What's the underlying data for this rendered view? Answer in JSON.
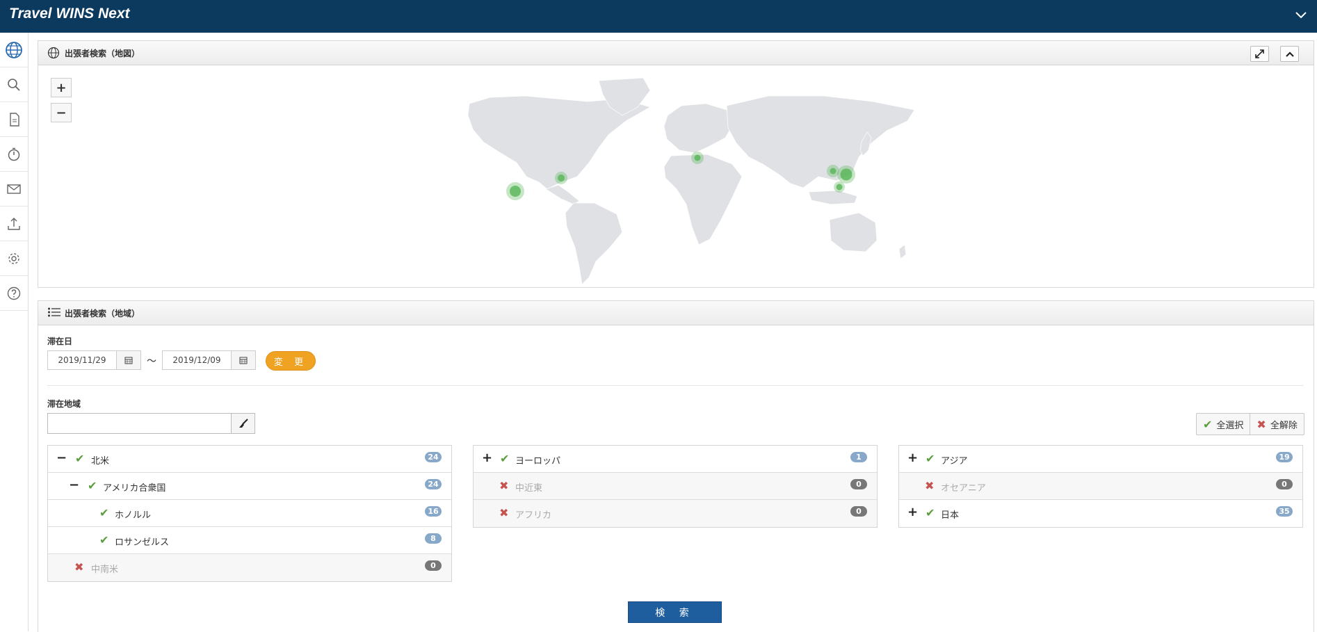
{
  "app": {
    "title": "Travel WINS Next"
  },
  "sidebar": {
    "items": [
      {
        "icon": "globe-icon"
      },
      {
        "icon": "search-icon"
      },
      {
        "icon": "document-icon"
      },
      {
        "icon": "timer-icon"
      },
      {
        "icon": "mail-icon"
      },
      {
        "icon": "upload-icon"
      },
      {
        "icon": "gear-icon"
      },
      {
        "icon": "help-icon"
      }
    ]
  },
  "map_panel": {
    "title": "出張者検索（地図）",
    "zoom_in": "+",
    "zoom_out": "−",
    "colors": {
      "land": "#dfe1e5",
      "marker": "#5cb85c"
    }
  },
  "region_panel": {
    "title": "出張者検索（地域）",
    "stay_date_label": "滞在日",
    "date_from": "2019/11/29",
    "tilde": "～",
    "date_to": "2019/12/09",
    "change_button": "変 更",
    "region_label": "滞在地域",
    "select_all": "全選択",
    "deselect_all": "全解除",
    "search_button": "検 索"
  },
  "trees": {
    "col1": [
      {
        "toggle": "−",
        "label": "北米",
        "count": "24",
        "state": "checked"
      },
      {
        "toggle": "−",
        "label": "アメリカ合衆国",
        "count": "24",
        "state": "checked"
      },
      {
        "toggle": "",
        "label": "ホノルル",
        "count": "16",
        "state": "checked"
      },
      {
        "toggle": "",
        "label": "ロサンゼルス",
        "count": "8",
        "state": "checked"
      },
      {
        "toggle": "",
        "label": "中南米",
        "count": "0",
        "state": "disabled"
      }
    ],
    "col2": [
      {
        "toggle": "+",
        "label": "ヨーロッパ",
        "count": "1",
        "state": "checked"
      },
      {
        "toggle": "",
        "label": "中近東",
        "count": "0",
        "state": "disabled"
      },
      {
        "toggle": "",
        "label": "アフリカ",
        "count": "0",
        "state": "disabled"
      }
    ],
    "col3": [
      {
        "toggle": "+",
        "label": "アジア",
        "count": "19",
        "state": "checked"
      },
      {
        "toggle": "",
        "label": "オセアニア",
        "count": "0",
        "state": "disabled"
      },
      {
        "toggle": "+",
        "label": "日本",
        "count": "35",
        "state": "checked"
      }
    ]
  }
}
